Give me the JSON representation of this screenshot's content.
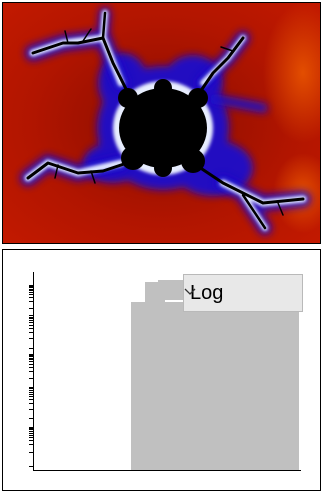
{
  "fractal": {
    "icon": "julia-fractal-render",
    "colors": {
      "edge": "#c51a00",
      "hot": "#e85400",
      "near": "#1c10cc",
      "glow": "#e8eeff",
      "core": "#000000"
    }
  },
  "histogram": {
    "scale": {
      "selected": "Log",
      "options": [
        "Log"
      ]
    },
    "bar_color": "#c0c0c0",
    "axis_color": "#000000"
  }
}
